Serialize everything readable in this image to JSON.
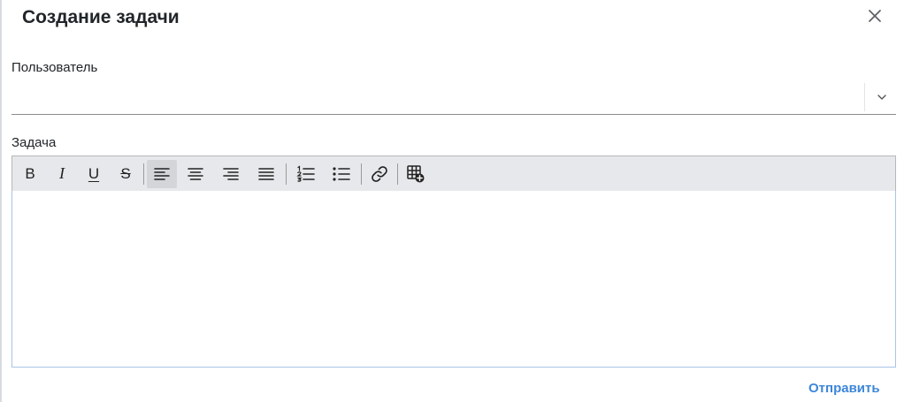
{
  "dialog": {
    "title": "Создание задачи",
    "close_icon": "close-icon",
    "submit_label": "Отправить"
  },
  "user_field": {
    "label": "Пользователь",
    "value": "",
    "icon": "chevron-down-icon"
  },
  "task_field": {
    "label": "Задача",
    "content": "",
    "toolbar": {
      "bold": "B",
      "italic": "I",
      "underline": "U",
      "strikethrough": "S",
      "icons": [
        "align-left-icon",
        "align-center-icon",
        "align-right-icon",
        "align-justify-icon",
        "ordered-list-icon",
        "bullet-list-icon",
        "link-icon",
        "table-add-icon"
      ],
      "active": "align-left"
    }
  },
  "colors": {
    "accent": "#3d86d8",
    "toolbar_bg": "#e7e8eb",
    "editor_border": "#a9c4e8"
  }
}
